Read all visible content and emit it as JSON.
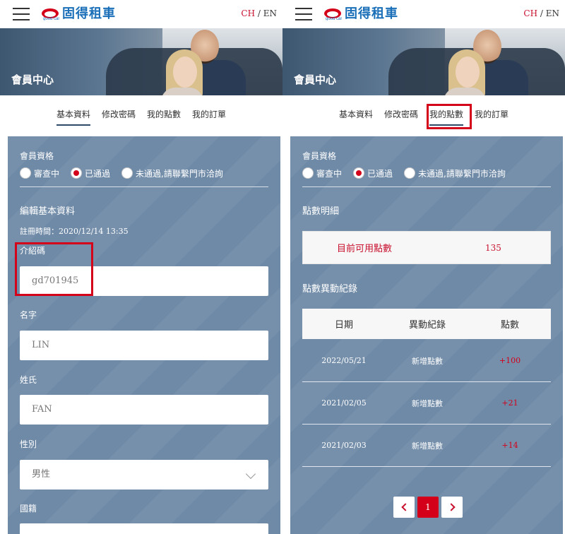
{
  "header": {
    "brand": "固得租車",
    "brand_sub": "good car",
    "lang_ch": "CH",
    "lang_sep": " / ",
    "lang_en": "EN"
  },
  "banner": {
    "title": "會員中心"
  },
  "tabs": [
    "基本資料",
    "修改密碼",
    "我的點數",
    "我的訂單"
  ],
  "membership": {
    "title": "會員資格",
    "options": [
      "審查中",
      "已通過",
      "未通過,請聯繫門市洽詢"
    ],
    "selected": "已通過"
  },
  "profile": {
    "section_title": "編輯基本資料",
    "registered": "註冊時間：2020/12/14 13:35",
    "referral_label": "介紹碼",
    "referral_value": "gd701945",
    "first_name_label": "名字",
    "first_name_value": "LIN",
    "last_name_label": "姓氏",
    "last_name_value": "FAN",
    "gender_label": "性別",
    "gender_value": "男性",
    "nationality_label": "國籍"
  },
  "points": {
    "detail_title": "點數明細",
    "available_label": "目前可用點數",
    "available_value": "135",
    "history_title": "點數異動紀錄",
    "columns": [
      "日期",
      "異動紀錄",
      "點數"
    ],
    "rows": [
      {
        "date": "2022/05/21",
        "record": "新增點數",
        "points": "+100"
      },
      {
        "date": "2021/02/05",
        "record": "新增點數",
        "points": "+21"
      },
      {
        "date": "2021/02/03",
        "record": "新增點數",
        "points": "+14"
      }
    ],
    "current_page": "1"
  },
  "colors": {
    "accent": "#d4001a",
    "card": "#6f8aa7",
    "brand": "#1a6fb8"
  }
}
